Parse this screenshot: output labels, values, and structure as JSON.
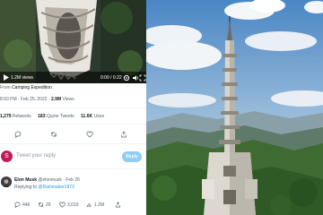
{
  "video": {
    "views": "1.2M views",
    "time": "0:00 / 0:22",
    "icons": [
      "play-icon",
      "settings-icon",
      "volume-icon",
      "fullscreen-icon"
    ]
  },
  "tweet": {
    "from_prefix": "From",
    "from_account": "Camping Expedition",
    "time": "8:50 PM",
    "date": "Feb 25, 2022",
    "views_count": "2.9M",
    "views_label": "Views",
    "retweets_count": "1,279",
    "retweets_label": "Retweets",
    "quotes_count": "183",
    "quotes_label": "Quote Tweets",
    "likes_count": "11.6K",
    "likes_label": "Likes"
  },
  "compose": {
    "avatar_letter": "S",
    "placeholder": "Tweet your reply",
    "reply_button": "Reply"
  },
  "reply_tweet": {
    "name": "Elon Musk",
    "handle": "@elonmusk",
    "date": "Feb 26",
    "replying_prefix": "Replying to",
    "replying_handle": "@Rainmaker1973",
    "replies": "446",
    "retweets": "29",
    "likes": "3,015",
    "views": "1.2M"
  },
  "colors": {
    "accent": "#1d9bf0",
    "reply_button": "#8ecdf8",
    "secondary_text": "#536471",
    "primary_text": "#0f1419"
  }
}
